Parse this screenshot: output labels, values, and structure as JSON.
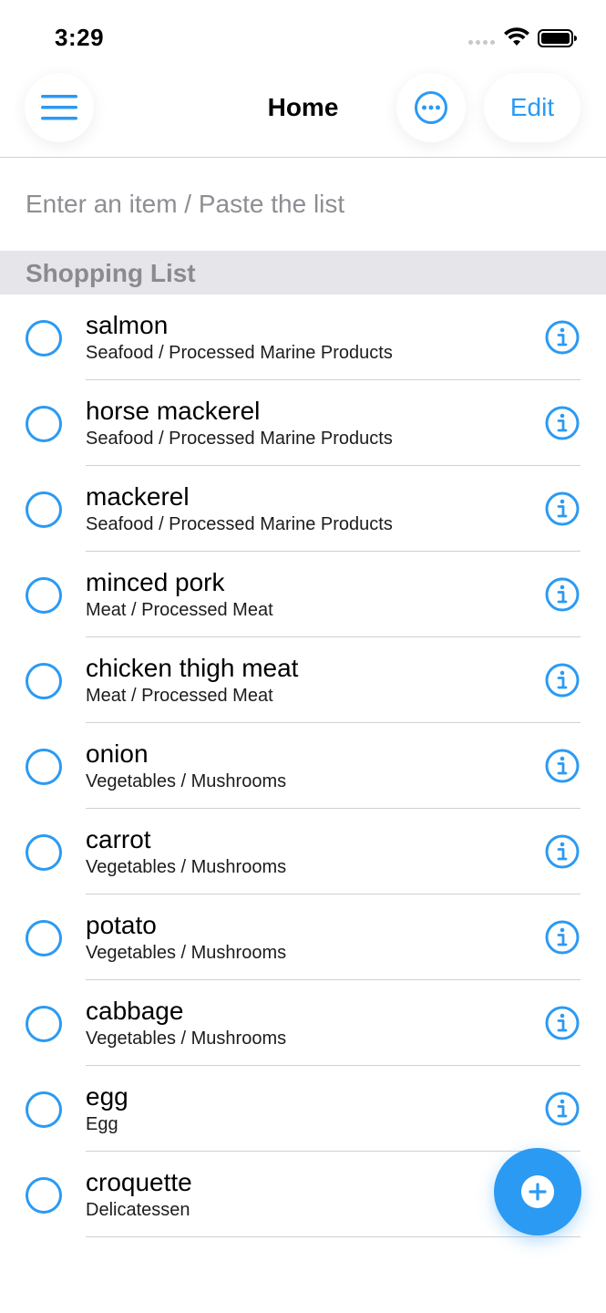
{
  "status": {
    "time": "3:29"
  },
  "nav": {
    "title": "Home",
    "edit_label": "Edit"
  },
  "entry": {
    "placeholder": "Enter an item / Paste the list",
    "value": ""
  },
  "section": {
    "title": "Shopping List"
  },
  "items": [
    {
      "name": "salmon",
      "category": "Seafood / Processed Marine Products"
    },
    {
      "name": "horse mackerel",
      "category": "Seafood / Processed Marine Products"
    },
    {
      "name": "mackerel",
      "category": "Seafood / Processed Marine Products"
    },
    {
      "name": "minced pork",
      "category": "Meat / Processed Meat"
    },
    {
      "name": "chicken thigh meat",
      "category": "Meat / Processed Meat"
    },
    {
      "name": "onion",
      "category": "Vegetables / Mushrooms"
    },
    {
      "name": "carrot",
      "category": "Vegetables / Mushrooms"
    },
    {
      "name": "potato",
      "category": "Vegetables / Mushrooms"
    },
    {
      "name": "cabbage",
      "category": "Vegetables / Mushrooms"
    },
    {
      "name": "egg",
      "category": "Egg"
    },
    {
      "name": "croquette",
      "category": "Delicatessen"
    }
  ],
  "colors": {
    "accent": "#2b9af3",
    "section_bg": "#e5e5ea",
    "separator": "#d1d1d6"
  },
  "icons": {
    "menu": "hamburger-menu-icon",
    "more": "ellipsis-circle-icon",
    "check": "empty-circle-checkbox-icon",
    "info": "info-circle-icon",
    "add": "plus-circle-icon"
  }
}
